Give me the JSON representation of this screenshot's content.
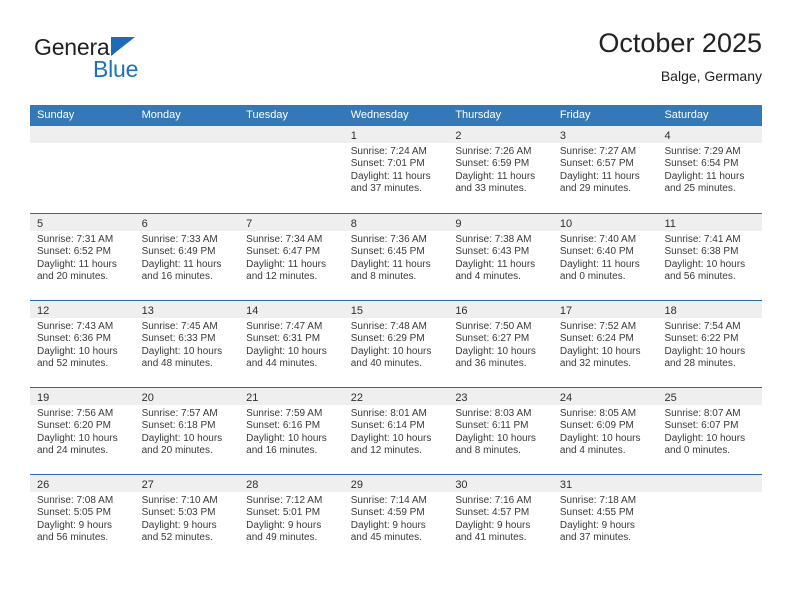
{
  "brand": {
    "name_dark": "General",
    "name_blue": "Blue",
    "triangle_color": "#1e6cb5",
    "blue": "#1e71b8"
  },
  "header": {
    "title": "October 2025",
    "subtitle": "Balge, Germany"
  },
  "colors": {
    "header_bar": "#3478b8",
    "week_divider": "#2a6ca8",
    "day_band": "#efefef",
    "text": "#3a3a3a"
  },
  "weekdays": [
    "Sunday",
    "Monday",
    "Tuesday",
    "Wednesday",
    "Thursday",
    "Friday",
    "Saturday"
  ],
  "weeks": [
    [
      {
        "day": "",
        "lines": []
      },
      {
        "day": "",
        "lines": []
      },
      {
        "day": "",
        "lines": []
      },
      {
        "day": "1",
        "lines": [
          "Sunrise: 7:24 AM",
          "Sunset: 7:01 PM",
          "Daylight: 11 hours",
          "and 37 minutes."
        ]
      },
      {
        "day": "2",
        "lines": [
          "Sunrise: 7:26 AM",
          "Sunset: 6:59 PM",
          "Daylight: 11 hours",
          "and 33 minutes."
        ]
      },
      {
        "day": "3",
        "lines": [
          "Sunrise: 7:27 AM",
          "Sunset: 6:57 PM",
          "Daylight: 11 hours",
          "and 29 minutes."
        ]
      },
      {
        "day": "4",
        "lines": [
          "Sunrise: 7:29 AM",
          "Sunset: 6:54 PM",
          "Daylight: 11 hours",
          "and 25 minutes."
        ]
      }
    ],
    [
      {
        "day": "5",
        "lines": [
          "Sunrise: 7:31 AM",
          "Sunset: 6:52 PM",
          "Daylight: 11 hours",
          "and 20 minutes."
        ]
      },
      {
        "day": "6",
        "lines": [
          "Sunrise: 7:33 AM",
          "Sunset: 6:49 PM",
          "Daylight: 11 hours",
          "and 16 minutes."
        ]
      },
      {
        "day": "7",
        "lines": [
          "Sunrise: 7:34 AM",
          "Sunset: 6:47 PM",
          "Daylight: 11 hours",
          "and 12 minutes."
        ]
      },
      {
        "day": "8",
        "lines": [
          "Sunrise: 7:36 AM",
          "Sunset: 6:45 PM",
          "Daylight: 11 hours",
          "and 8 minutes."
        ]
      },
      {
        "day": "9",
        "lines": [
          "Sunrise: 7:38 AM",
          "Sunset: 6:43 PM",
          "Daylight: 11 hours",
          "and 4 minutes."
        ]
      },
      {
        "day": "10",
        "lines": [
          "Sunrise: 7:40 AM",
          "Sunset: 6:40 PM",
          "Daylight: 11 hours",
          "and 0 minutes."
        ]
      },
      {
        "day": "11",
        "lines": [
          "Sunrise: 7:41 AM",
          "Sunset: 6:38 PM",
          "Daylight: 10 hours",
          "and 56 minutes."
        ]
      }
    ],
    [
      {
        "day": "12",
        "lines": [
          "Sunrise: 7:43 AM",
          "Sunset: 6:36 PM",
          "Daylight: 10 hours",
          "and 52 minutes."
        ]
      },
      {
        "day": "13",
        "lines": [
          "Sunrise: 7:45 AM",
          "Sunset: 6:33 PM",
          "Daylight: 10 hours",
          "and 48 minutes."
        ]
      },
      {
        "day": "14",
        "lines": [
          "Sunrise: 7:47 AM",
          "Sunset: 6:31 PM",
          "Daylight: 10 hours",
          "and 44 minutes."
        ]
      },
      {
        "day": "15",
        "lines": [
          "Sunrise: 7:48 AM",
          "Sunset: 6:29 PM",
          "Daylight: 10 hours",
          "and 40 minutes."
        ]
      },
      {
        "day": "16",
        "lines": [
          "Sunrise: 7:50 AM",
          "Sunset: 6:27 PM",
          "Daylight: 10 hours",
          "and 36 minutes."
        ]
      },
      {
        "day": "17",
        "lines": [
          "Sunrise: 7:52 AM",
          "Sunset: 6:24 PM",
          "Daylight: 10 hours",
          "and 32 minutes."
        ]
      },
      {
        "day": "18",
        "lines": [
          "Sunrise: 7:54 AM",
          "Sunset: 6:22 PM",
          "Daylight: 10 hours",
          "and 28 minutes."
        ]
      }
    ],
    [
      {
        "day": "19",
        "lines": [
          "Sunrise: 7:56 AM",
          "Sunset: 6:20 PM",
          "Daylight: 10 hours",
          "and 24 minutes."
        ]
      },
      {
        "day": "20",
        "lines": [
          "Sunrise: 7:57 AM",
          "Sunset: 6:18 PM",
          "Daylight: 10 hours",
          "and 20 minutes."
        ]
      },
      {
        "day": "21",
        "lines": [
          "Sunrise: 7:59 AM",
          "Sunset: 6:16 PM",
          "Daylight: 10 hours",
          "and 16 minutes."
        ]
      },
      {
        "day": "22",
        "lines": [
          "Sunrise: 8:01 AM",
          "Sunset: 6:14 PM",
          "Daylight: 10 hours",
          "and 12 minutes."
        ]
      },
      {
        "day": "23",
        "lines": [
          "Sunrise: 8:03 AM",
          "Sunset: 6:11 PM",
          "Daylight: 10 hours",
          "and 8 minutes."
        ]
      },
      {
        "day": "24",
        "lines": [
          "Sunrise: 8:05 AM",
          "Sunset: 6:09 PM",
          "Daylight: 10 hours",
          "and 4 minutes."
        ]
      },
      {
        "day": "25",
        "lines": [
          "Sunrise: 8:07 AM",
          "Sunset: 6:07 PM",
          "Daylight: 10 hours",
          "and 0 minutes."
        ]
      }
    ],
    [
      {
        "day": "26",
        "lines": [
          "Sunrise: 7:08 AM",
          "Sunset: 5:05 PM",
          "Daylight: 9 hours",
          "and 56 minutes."
        ]
      },
      {
        "day": "27",
        "lines": [
          "Sunrise: 7:10 AM",
          "Sunset: 5:03 PM",
          "Daylight: 9 hours",
          "and 52 minutes."
        ]
      },
      {
        "day": "28",
        "lines": [
          "Sunrise: 7:12 AM",
          "Sunset: 5:01 PM",
          "Daylight: 9 hours",
          "and 49 minutes."
        ]
      },
      {
        "day": "29",
        "lines": [
          "Sunrise: 7:14 AM",
          "Sunset: 4:59 PM",
          "Daylight: 9 hours",
          "and 45 minutes."
        ]
      },
      {
        "day": "30",
        "lines": [
          "Sunrise: 7:16 AM",
          "Sunset: 4:57 PM",
          "Daylight: 9 hours",
          "and 41 minutes."
        ]
      },
      {
        "day": "31",
        "lines": [
          "Sunrise: 7:18 AM",
          "Sunset: 4:55 PM",
          "Daylight: 9 hours",
          "and 37 minutes."
        ]
      },
      {
        "day": "",
        "lines": []
      }
    ]
  ]
}
